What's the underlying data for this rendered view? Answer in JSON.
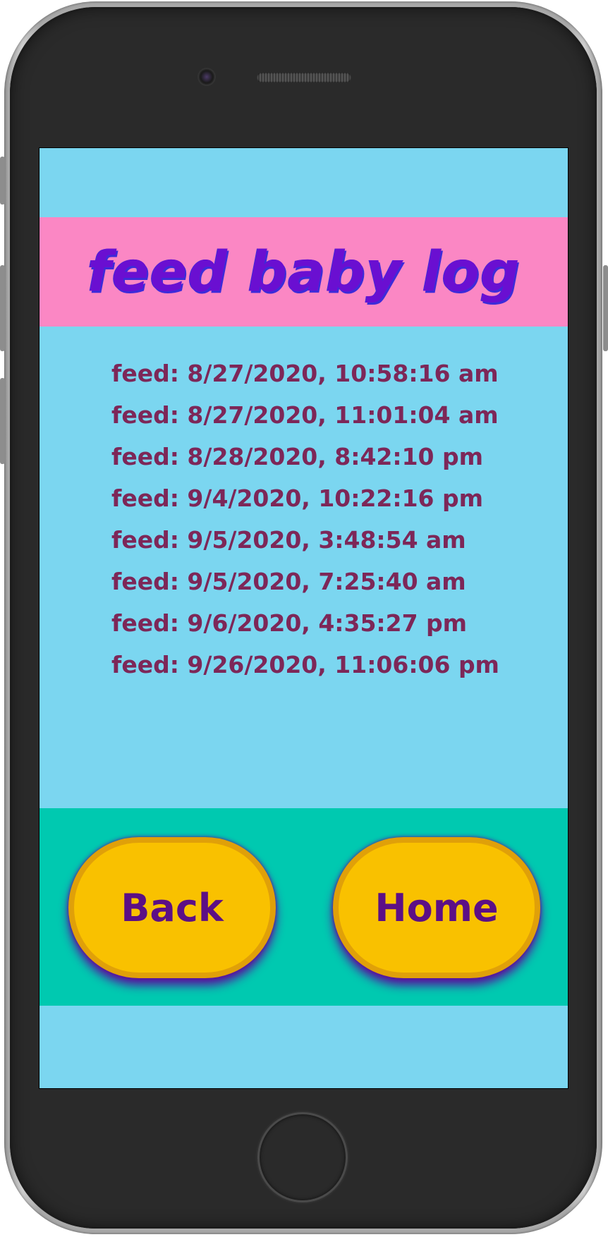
{
  "app": {
    "title": "feed baby log"
  },
  "log": {
    "entries": [
      "feed: 8/27/2020, 10:58:16 am",
      "feed: 8/27/2020, 11:01:04 am",
      "feed: 8/28/2020, 8:42:10 pm",
      "feed: 9/4/2020, 10:22:16 pm",
      "feed: 9/5/2020, 3:48:54 am",
      "feed: 9/5/2020, 7:25:40 am",
      "feed: 9/6/2020, 4:35:27 pm",
      "feed: 9/26/2020, 11:06:06 pm"
    ]
  },
  "nav": {
    "back_label": "Back",
    "home_label": "Home"
  },
  "colors": {
    "screen_bg": "#7bd6f0",
    "title_bar": "#fb87c4",
    "title_text": "#6a0fd1",
    "log_text": "#7d2758",
    "nav_bar": "#00c9b0",
    "button_fill": "#f9c100",
    "button_border": "#e0a009",
    "button_text": "#5c0f86"
  }
}
